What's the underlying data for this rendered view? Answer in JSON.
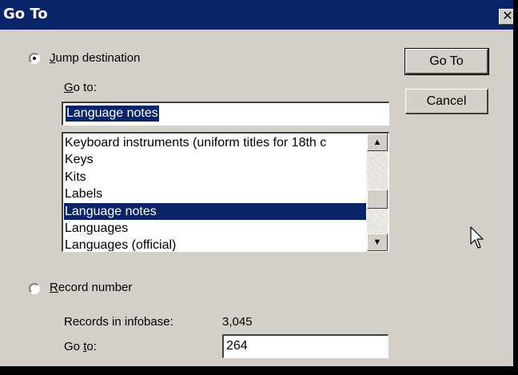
{
  "window": {
    "title": "Go To",
    "close_glyph": "✕"
  },
  "jump": {
    "radio_label_first": "J",
    "radio_label_rest": "ump destination",
    "goto_label_first": "G",
    "goto_label_rest": "o to:",
    "goto_value": "Language notes",
    "list": [
      "Keyboard instruments (uniform titles for 18th c",
      "Keys",
      "Kits",
      "Labels",
      "Language notes",
      "Languages",
      "Languages (official)"
    ],
    "selected_index": 4
  },
  "record": {
    "radio_label_first": "R",
    "radio_label_rest": "ecord number",
    "records_label": "Records in infobase:",
    "records_value": "3,045",
    "goto_label_prefix": "Go ",
    "goto_label_u": "t",
    "goto_label_rest": "o:",
    "goto_value": "264"
  },
  "buttons": {
    "goto": "Go To",
    "cancel": "Cancel"
  },
  "icons": {
    "scroll_up": "▲",
    "scroll_down": "▼",
    "cursor": "arrow-cursor-icon"
  }
}
